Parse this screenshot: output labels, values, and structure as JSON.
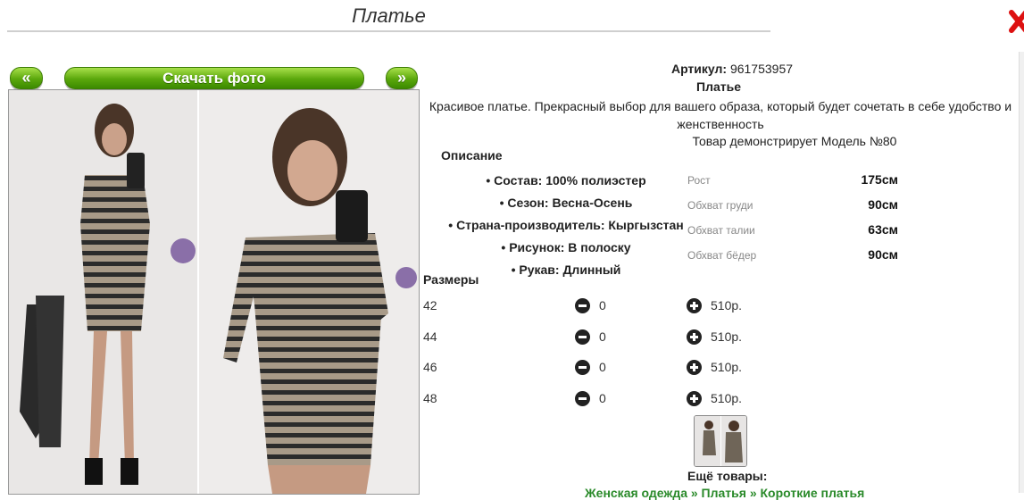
{
  "header": {
    "title": "Платье"
  },
  "nav": {
    "prev": "«",
    "download": "Скачать фото",
    "next": "»"
  },
  "product": {
    "article_label": "Артикул:",
    "article_value": "961753957",
    "name": "Платье",
    "description": "Красивое платье. Прекрасный выбор для вашего образа, который будет сочетать в себе удобство и женственность",
    "model_note": "Товар демонстрирует Модель №80",
    "desc_heading": "Описание",
    "features": [
      "Состав: 100% полиэстер",
      "Сезон: Весна-Осень",
      "Страна-производитель: Кыргызстан",
      "Рисунок: В полоску",
      "Рукав: Длинный"
    ],
    "measurements": [
      {
        "label": "Рост",
        "value": "175см"
      },
      {
        "label": "Обхват груди",
        "value": "90см"
      },
      {
        "label": "Обхват талии",
        "value": "63см"
      },
      {
        "label": "Обхват бёдер",
        "value": "90см"
      }
    ]
  },
  "sizes": {
    "heading": "Размеры",
    "rows": [
      {
        "size": "42",
        "qty": "0",
        "price": "510р."
      },
      {
        "size": "44",
        "qty": "0",
        "price": "510р."
      },
      {
        "size": "46",
        "qty": "0",
        "price": "510р."
      },
      {
        "size": "48",
        "qty": "0",
        "price": "510р."
      }
    ]
  },
  "more": {
    "label": "Ещё товары:",
    "links": "Женская одежда » Платья » Короткие платья"
  },
  "colors": {
    "accent_green": "#5aa70c",
    "close_red": "#d11"
  }
}
